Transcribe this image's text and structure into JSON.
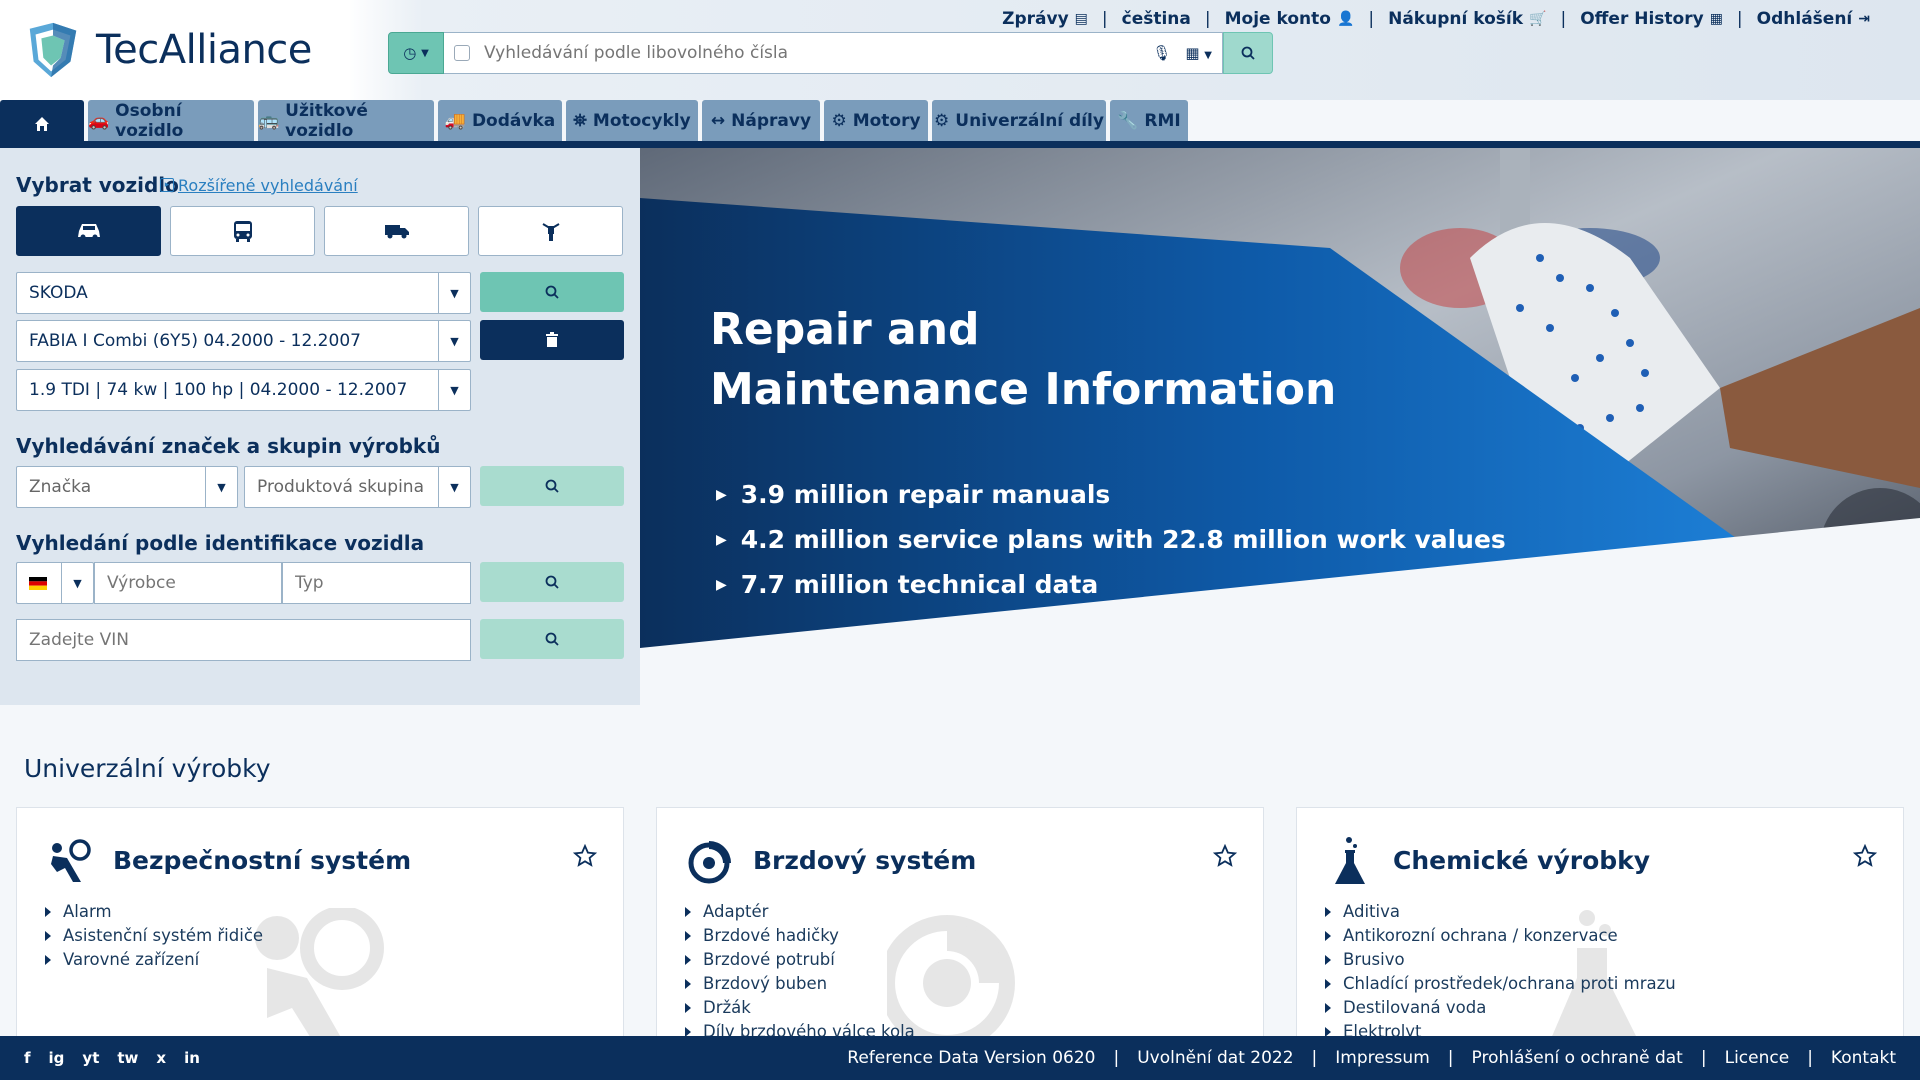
{
  "brand": {
    "logo_text": "TecAlliance"
  },
  "search": {
    "placeholder": "Vyhledávání podle libovolného čísla"
  },
  "topnav": {
    "items": [
      {
        "label": "Zprávy",
        "icon": "document-icon"
      },
      {
        "label": "čeština",
        "icon": ""
      },
      {
        "label": "Moje konto",
        "icon": "user-gear-icon"
      },
      {
        "label": "Nákupní košík",
        "icon": "cart-icon"
      },
      {
        "label": "Offer History",
        "icon": "calendar-icon"
      },
      {
        "label": "Odhlášení",
        "icon": "logout-icon"
      }
    ]
  },
  "tabs": [
    {
      "label": "",
      "icon": "home-icon"
    },
    {
      "label": "Osobní vozidlo",
      "icon": "car-icon"
    },
    {
      "label": "Užitkové vozidlo",
      "icon": "bus-icon"
    },
    {
      "label": "Dodávka",
      "icon": "truck-icon"
    },
    {
      "label": "Motocykly",
      "icon": "motorcycle-icon"
    },
    {
      "label": "Nápravy",
      "icon": "axle-icon"
    },
    {
      "label": "Motory",
      "icon": "engine-icon"
    },
    {
      "label": "Univerzální díly",
      "icon": "gear-icon"
    },
    {
      "label": "RMI",
      "icon": "wrench-icon"
    }
  ],
  "vehicle_select": {
    "title": "Vybrat vozidlo",
    "advanced_link": "Rozšířené vyhledávání",
    "make": "SKODA",
    "model": "FABIA I Combi (6Y5) 04.2000 - 12.2007",
    "engine": "1.9 TDI | 74 kw | 100 hp | 04.2000 - 12.2007"
  },
  "brand_search": {
    "title": "Vyhledávání značek a skupin výrobků",
    "brand_placeholder": "Značka",
    "group_placeholder": "Produktová skupina"
  },
  "vehicle_id": {
    "title": "Vyhledání podle identifikace vozidla",
    "manufacturer_placeholder": "Výrobce",
    "type_placeholder": "Typ",
    "vin_placeholder": "Zadejte VIN"
  },
  "banner": {
    "title_line1": "Repair and",
    "title_line2": "Maintenance Information",
    "bullets": [
      "3.9 million repair manuals",
      "4.2 million service plans with 22.8 million work values",
      "7.7 million technical data"
    ]
  },
  "universal": {
    "title": "Univerzální výrobky",
    "cards": [
      {
        "title": "Bezpečnostní systém",
        "icon": "airbag-icon",
        "items": [
          "Alarm",
          "Asistenční systém řidiče",
          "Varovné zařízení"
        ]
      },
      {
        "title": "Brzdový systém",
        "icon": "brake-disc-icon",
        "items": [
          "Adaptér",
          "Brzdové hadičky",
          "Brzdové potrubí",
          "Brzdový buben",
          "Držák",
          "Díly brzdového válce kola"
        ]
      },
      {
        "title": "Chemické výrobky",
        "icon": "chemical-flask-icon",
        "items": [
          "Aditiva",
          "Antikorozní ochrana / konzervace",
          "Brusivo",
          "Chladící prostředek/ochrana proti mrazu",
          "Destilovaná voda",
          "Elektrolyt"
        ]
      }
    ]
  },
  "footer": {
    "social": [
      "f",
      "ig",
      "yt",
      "tw",
      "x",
      "in"
    ],
    "links": [
      "Reference Data Version 0620",
      "Uvolnění dat 2022",
      "Impressum",
      "Prohlášení o ochraně dat",
      "Licence",
      "Kontakt"
    ]
  },
  "colors": {
    "navy": "#0b2f5c",
    "teal": "#6ec5b3",
    "tab": "#7a9cbb",
    "panel": "#dde6ef"
  }
}
